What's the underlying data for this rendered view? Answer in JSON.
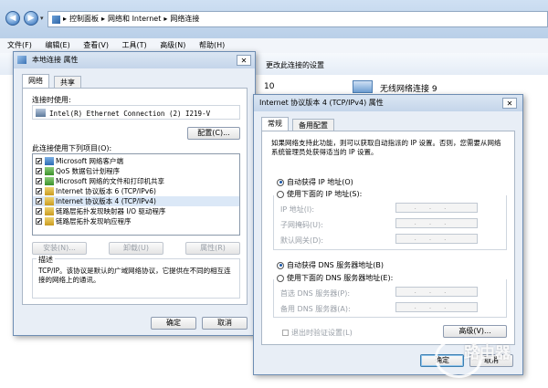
{
  "explorer": {
    "breadcrumb": [
      "控制面板",
      "网络和 Internet",
      "网络连接"
    ],
    "menu": [
      "文件(F)",
      "编辑(E)",
      "查看(V)",
      "工具(T)",
      "高级(N)",
      "帮助(H)"
    ],
    "toolbar_action": "更改此连接的设置",
    "item_partial_1": "10",
    "wireless_connection": "无线网络连接 9"
  },
  "local_dialog": {
    "title": "本地连接 属性",
    "tabs": [
      "网络",
      "共享"
    ],
    "connect_using_label": "连接时使用:",
    "adapter_name": "Intel(R) Ethernet Connection (2) I219-V",
    "configure_button": "配置(C)...",
    "items_label": "此连接使用下列项目(O):",
    "items": [
      "Microsoft 网络客户端",
      "QoS 数据包计划程序",
      "Microsoft 网络的文件和打印机共享",
      "Internet 协议版本 6 (TCP/IPv6)",
      "Internet 协议版本 4 (TCP/IPv4)",
      "链路层拓扑发现映射器 I/O 驱动程序",
      "链路层拓扑发现响应程序"
    ],
    "install_button": "安装(N)...",
    "uninstall_button": "卸载(U)",
    "properties_button": "属性(R)",
    "description_label": "描述",
    "description_text": "TCP/IP。该协议是默认的广域网络协议，它提供在不同的相互连接的网络上的通讯。",
    "ok_button": "确定",
    "cancel_button": "取消"
  },
  "ipv4_dialog": {
    "title": "Internet 协议版本 4 (TCP/IPv4) 属性",
    "tabs": [
      "常规",
      "备用配置"
    ],
    "intro": "如果网络支持此功能，则可以获取自动指派的 IP 设置。否则，您需要从网络系统管理员处获得适当的 IP 设置。",
    "auto_ip": "自动获得 IP 地址(O)",
    "manual_ip": "使用下面的 IP 地址(S):",
    "ip_address_label": "IP 地址(I):",
    "subnet_label": "子网掩码(U):",
    "gateway_label": "默认网关(D):",
    "auto_dns": "自动获得 DNS 服务器地址(B)",
    "manual_dns": "使用下面的 DNS 服务器地址(E):",
    "preferred_dns_label": "首选 DNS 服务器(P):",
    "alternate_dns_label": "备用 DNS 服务器(A):",
    "validate_label": "退出时验证设置(L)",
    "advanced_button": "高级(V)...",
    "ok_button": "确定",
    "cancel_button": "取消"
  },
  "watermark": "路由器"
}
